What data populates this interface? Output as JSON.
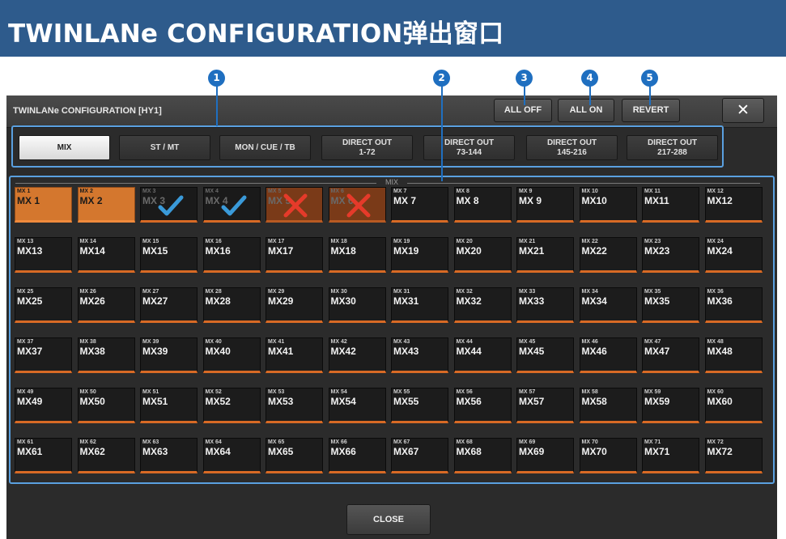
{
  "header": {
    "title": "TWINLANe CONFIGURATION弹出窗口"
  },
  "callouts": [
    "1",
    "2",
    "3",
    "4",
    "5"
  ],
  "window": {
    "title": "TWINLANe CONFIGURATION [HY1]",
    "buttons": {
      "all_off": "ALL OFF",
      "all_on": "ALL ON",
      "revert": "REVERT",
      "close_x": "✕"
    },
    "close_button": "CLOSE"
  },
  "tabs": [
    {
      "line1": "MIX",
      "line2": "",
      "active": true
    },
    {
      "line1": "ST / MT",
      "line2": "",
      "active": false
    },
    {
      "line1": "MON / CUE / TB",
      "line2": "",
      "active": false
    },
    {
      "line1": "DIRECT OUT",
      "line2": "1-72",
      "active": false
    },
    {
      "line1": "DIRECT OUT",
      "line2": "73-144",
      "active": false
    },
    {
      "line1": "DIRECT OUT",
      "line2": "145-216",
      "active": false
    },
    {
      "line1": "DIRECT OUT",
      "line2": "217-288",
      "active": false
    }
  ],
  "grid": {
    "label": "MIX",
    "cells": [
      {
        "small": "MX 1",
        "big": "MX 1",
        "state": "on",
        "mark": ""
      },
      {
        "small": "MX 2",
        "big": "MX 2",
        "state": "on",
        "mark": ""
      },
      {
        "small": "MX 3",
        "big": "MX 3",
        "state": "dim",
        "mark": "check"
      },
      {
        "small": "MX 4",
        "big": "MX 4",
        "state": "dim",
        "mark": "check"
      },
      {
        "small": "MX 5",
        "big": "MX 5",
        "state": "on-dim",
        "mark": "cross"
      },
      {
        "small": "MX 6",
        "big": "MX 6",
        "state": "on-dim",
        "mark": "cross"
      },
      {
        "small": "MX 7",
        "big": "MX 7",
        "state": "off",
        "mark": ""
      },
      {
        "small": "MX 8",
        "big": "MX 8",
        "state": "off",
        "mark": ""
      },
      {
        "small": "MX 9",
        "big": "MX 9",
        "state": "off",
        "mark": ""
      },
      {
        "small": "MX 10",
        "big": "MX10",
        "state": "off",
        "mark": ""
      },
      {
        "small": "MX 11",
        "big": "MX11",
        "state": "off",
        "mark": ""
      },
      {
        "small": "MX 12",
        "big": "MX12",
        "state": "off",
        "mark": ""
      },
      {
        "small": "MX 13",
        "big": "MX13",
        "state": "off",
        "mark": ""
      },
      {
        "small": "MX 14",
        "big": "MX14",
        "state": "off",
        "mark": ""
      },
      {
        "small": "MX 15",
        "big": "MX15",
        "state": "off",
        "mark": ""
      },
      {
        "small": "MX 16",
        "big": "MX16",
        "state": "off",
        "mark": ""
      },
      {
        "small": "MX 17",
        "big": "MX17",
        "state": "off",
        "mark": ""
      },
      {
        "small": "MX 18",
        "big": "MX18",
        "state": "off",
        "mark": ""
      },
      {
        "small": "MX 19",
        "big": "MX19",
        "state": "off",
        "mark": ""
      },
      {
        "small": "MX 20",
        "big": "MX20",
        "state": "off",
        "mark": ""
      },
      {
        "small": "MX 21",
        "big": "MX21",
        "state": "off",
        "mark": ""
      },
      {
        "small": "MX 22",
        "big": "MX22",
        "state": "off",
        "mark": ""
      },
      {
        "small": "MX 23",
        "big": "MX23",
        "state": "off",
        "mark": ""
      },
      {
        "small": "MX 24",
        "big": "MX24",
        "state": "off",
        "mark": ""
      },
      {
        "small": "MX 25",
        "big": "MX25",
        "state": "off",
        "mark": ""
      },
      {
        "small": "MX 26",
        "big": "MX26",
        "state": "off",
        "mark": ""
      },
      {
        "small": "MX 27",
        "big": "MX27",
        "state": "off",
        "mark": ""
      },
      {
        "small": "MX 28",
        "big": "MX28",
        "state": "off",
        "mark": ""
      },
      {
        "small": "MX 29",
        "big": "MX29",
        "state": "off",
        "mark": ""
      },
      {
        "small": "MX 30",
        "big": "MX30",
        "state": "off",
        "mark": ""
      },
      {
        "small": "MX 31",
        "big": "MX31",
        "state": "off",
        "mark": ""
      },
      {
        "small": "MX 32",
        "big": "MX32",
        "state": "off",
        "mark": ""
      },
      {
        "small": "MX 33",
        "big": "MX33",
        "state": "off",
        "mark": ""
      },
      {
        "small": "MX 34",
        "big": "MX34",
        "state": "off",
        "mark": ""
      },
      {
        "small": "MX 35",
        "big": "MX35",
        "state": "off",
        "mark": ""
      },
      {
        "small": "MX 36",
        "big": "MX36",
        "state": "off",
        "mark": ""
      },
      {
        "small": "MX 37",
        "big": "MX37",
        "state": "off",
        "mark": ""
      },
      {
        "small": "MX 38",
        "big": "MX38",
        "state": "off",
        "mark": ""
      },
      {
        "small": "MX 39",
        "big": "MX39",
        "state": "off",
        "mark": ""
      },
      {
        "small": "MX 40",
        "big": "MX40",
        "state": "off",
        "mark": ""
      },
      {
        "small": "MX 41",
        "big": "MX41",
        "state": "off",
        "mark": ""
      },
      {
        "small": "MX 42",
        "big": "MX42",
        "state": "off",
        "mark": ""
      },
      {
        "small": "MX 43",
        "big": "MX43",
        "state": "off",
        "mark": ""
      },
      {
        "small": "MX 44",
        "big": "MX44",
        "state": "off",
        "mark": ""
      },
      {
        "small": "MX 45",
        "big": "MX45",
        "state": "off",
        "mark": ""
      },
      {
        "small": "MX 46",
        "big": "MX46",
        "state": "off",
        "mark": ""
      },
      {
        "small": "MX 47",
        "big": "MX47",
        "state": "off",
        "mark": ""
      },
      {
        "small": "MX 48",
        "big": "MX48",
        "state": "off",
        "mark": ""
      },
      {
        "small": "MX 49",
        "big": "MX49",
        "state": "off",
        "mark": ""
      },
      {
        "small": "MX 50",
        "big": "MX50",
        "state": "off",
        "mark": ""
      },
      {
        "small": "MX 51",
        "big": "MX51",
        "state": "off",
        "mark": ""
      },
      {
        "small": "MX 52",
        "big": "MX52",
        "state": "off",
        "mark": ""
      },
      {
        "small": "MX 53",
        "big": "MX53",
        "state": "off",
        "mark": ""
      },
      {
        "small": "MX 54",
        "big": "MX54",
        "state": "off",
        "mark": ""
      },
      {
        "small": "MX 55",
        "big": "MX55",
        "state": "off",
        "mark": ""
      },
      {
        "small": "MX 56",
        "big": "MX56",
        "state": "off",
        "mark": ""
      },
      {
        "small": "MX 57",
        "big": "MX57",
        "state": "off",
        "mark": ""
      },
      {
        "small": "MX 58",
        "big": "MX58",
        "state": "off",
        "mark": ""
      },
      {
        "small": "MX 59",
        "big": "MX59",
        "state": "off",
        "mark": ""
      },
      {
        "small": "MX 60",
        "big": "MX60",
        "state": "off",
        "mark": ""
      },
      {
        "small": "MX 61",
        "big": "MX61",
        "state": "off",
        "mark": ""
      },
      {
        "small": "MX 62",
        "big": "MX62",
        "state": "off",
        "mark": ""
      },
      {
        "small": "MX 63",
        "big": "MX63",
        "state": "off",
        "mark": ""
      },
      {
        "small": "MX 64",
        "big": "MX64",
        "state": "off",
        "mark": ""
      },
      {
        "small": "MX 65",
        "big": "MX65",
        "state": "off",
        "mark": ""
      },
      {
        "small": "MX 66",
        "big": "MX66",
        "state": "off",
        "mark": ""
      },
      {
        "small": "MX 67",
        "big": "MX67",
        "state": "off",
        "mark": ""
      },
      {
        "small": "MX 68",
        "big": "MX68",
        "state": "off",
        "mark": ""
      },
      {
        "small": "MX 69",
        "big": "MX69",
        "state": "off",
        "mark": ""
      },
      {
        "small": "MX 70",
        "big": "MX70",
        "state": "off",
        "mark": ""
      },
      {
        "small": "MX 71",
        "big": "MX71",
        "state": "off",
        "mark": ""
      },
      {
        "small": "MX 72",
        "big": "MX72",
        "state": "off",
        "mark": ""
      }
    ]
  },
  "colors": {
    "header_bg": "#2e5b8c",
    "callout": "#1f6fc0",
    "frame": "#5aa0e0",
    "cell_on": "#d4772e",
    "accent_bar": "#d86a25",
    "check": "#3a9ad9",
    "cross": "#e53a2a"
  }
}
